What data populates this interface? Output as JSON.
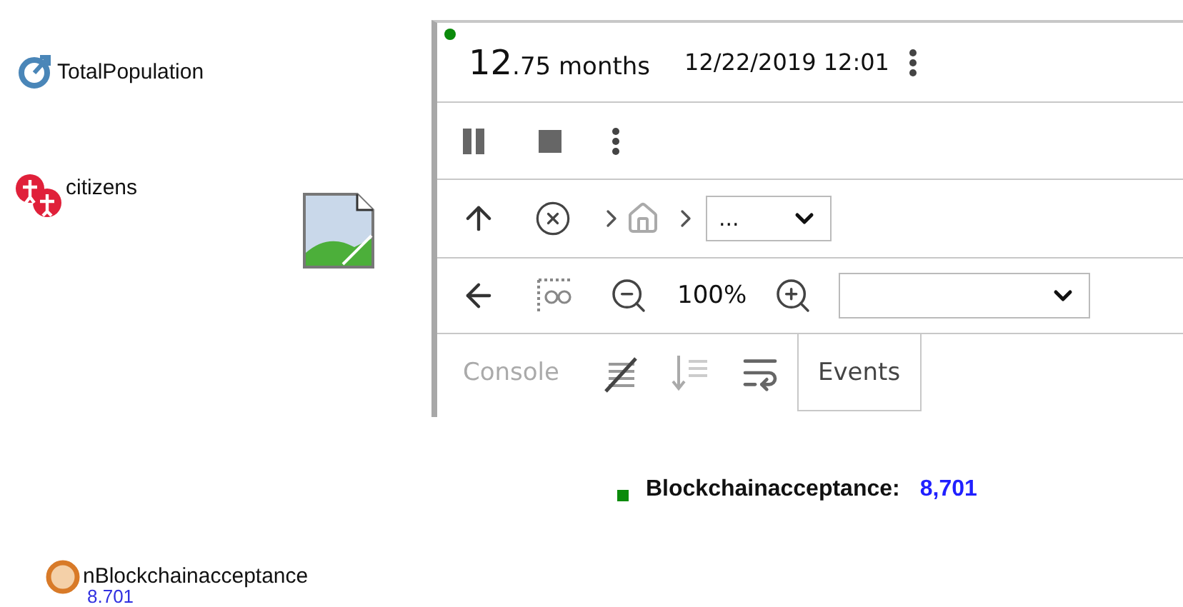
{
  "canvas": {
    "parameter": {
      "label": "TotalPopulation"
    },
    "population": {
      "label": "citizens"
    },
    "variable": {
      "label": "nBlockchainacceptance",
      "value": "8.701"
    },
    "text_output": {
      "label": "Blockchainacceptance:",
      "value": "8,701"
    }
  },
  "developer_panel": {
    "running": true,
    "time": {
      "whole": "12",
      "fraction": ".75 months"
    },
    "date": "12/22/2019 12:01",
    "navigation": {
      "select_value": "..."
    },
    "zoom": {
      "value": "100%"
    },
    "tabs": [
      {
        "label": "Console",
        "selected": false
      },
      {
        "label": "Events",
        "selected": true
      }
    ]
  }
}
